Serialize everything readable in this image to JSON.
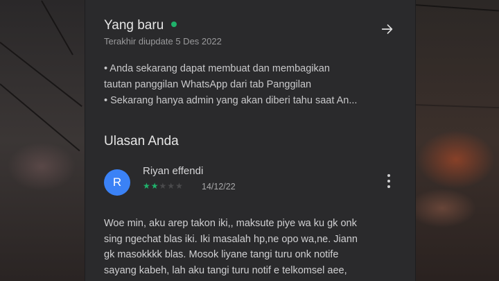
{
  "whats_new": {
    "title": "Yang baru",
    "updated": "Terakhir diupdate 5 Des 2022",
    "notes": [
      "• Anda sekarang dapat membuat dan membagikan",
      "tautan panggilan WhatsApp dari tab Panggilan",
      "• Sekarang hanya admin yang akan diberi tahu saat An..."
    ]
  },
  "reviews": {
    "title": "Ulasan Anda",
    "review": {
      "avatar_letter": "R",
      "name": "Riyan effendi",
      "rating": 2,
      "max_rating": 5,
      "date": "14/12/22",
      "text_lines": [
        "Woe min, aku arep takon iki,, maksute piye wa ku gk onk",
        "sing ngechat blas iki. Iki masalah hp,ne opo wa,ne. Jiann",
        "gk masokkkk blas. Mosok liyane tangi turu onk notife",
        "sayang kabeh, lah aku tangi turu notif e telkomsel aee,"
      ]
    }
  },
  "icons": {
    "arrow": "arrow-right-icon",
    "more": "more-vert-icon",
    "star": "star-icon"
  },
  "colors": {
    "accent_green": "#1fb26b",
    "avatar_blue": "#3b82f6",
    "panel_bg": "#2a2a2c"
  }
}
